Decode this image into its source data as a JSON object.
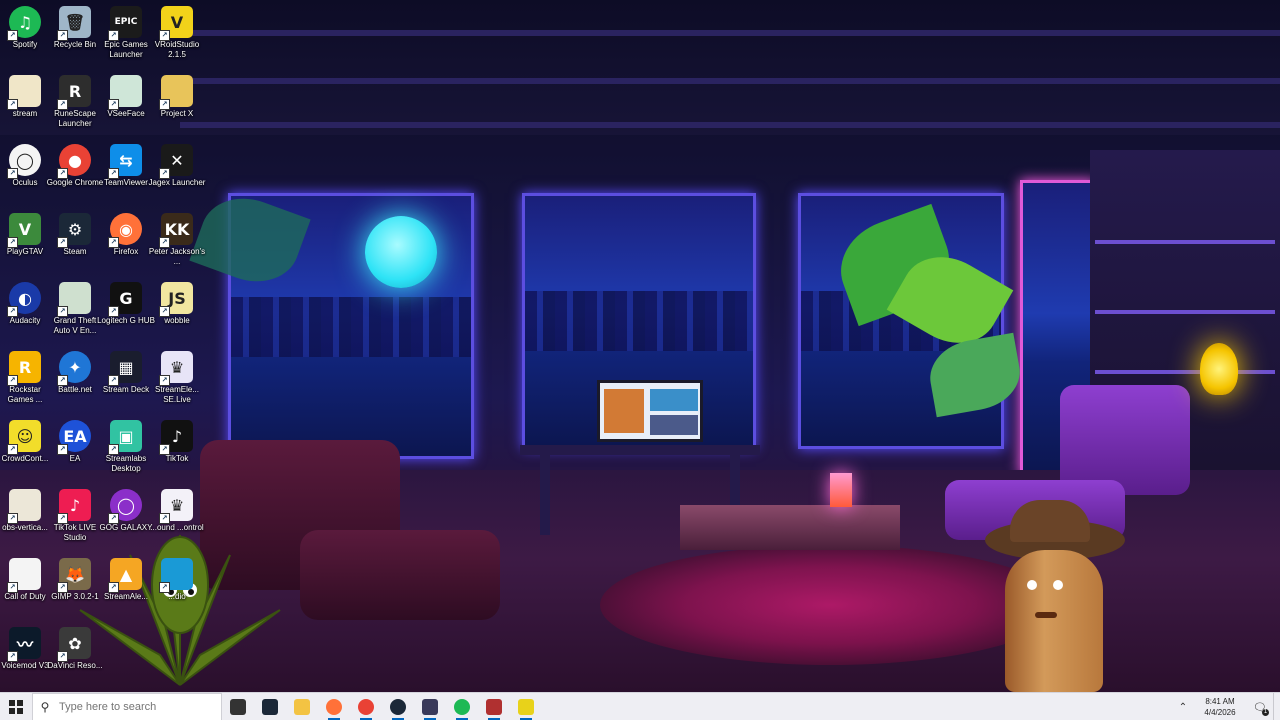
{
  "desktop": {
    "icons": [
      {
        "label": "Spotify",
        "color": "#1db954",
        "glyph": "♫"
      },
      {
        "label": "Recycle Bin",
        "color": "#9fb6c8",
        "glyph": "🗑"
      },
      {
        "label": "Epic Games Launcher",
        "color": "#1b1b1b",
        "glyph": "EPIC"
      },
      {
        "label": "VRoidStudio 2.1.5",
        "color": "#f2d21a",
        "glyph": "V"
      },
      {
        "label": "stream",
        "color": "#f0e6c8",
        "glyph": ""
      },
      {
        "label": "RuneScape Launcher",
        "color": "#2d2d2d",
        "glyph": "R"
      },
      {
        "label": "VSeeFace",
        "color": "#cfe6d8",
        "glyph": ""
      },
      {
        "label": "Project X",
        "color": "#e8c45a",
        "glyph": ""
      },
      {
        "label": "Oculus",
        "color": "#f4f4f4",
        "glyph": "◯"
      },
      {
        "label": "Google Chrome",
        "color": "#e94235",
        "glyph": "●"
      },
      {
        "label": "TeamViewer",
        "color": "#0e8ee9",
        "glyph": "⇆"
      },
      {
        "label": "Jagex Launcher",
        "color": "#1a1a1a",
        "glyph": "✕"
      },
      {
        "label": "PlayGTAV",
        "color": "#3c8a3c",
        "glyph": "V"
      },
      {
        "label": "Steam",
        "color": "#1b2838",
        "glyph": "⚙"
      },
      {
        "label": "Firefox",
        "color": "#ff7139",
        "glyph": "◉"
      },
      {
        "label": "Peter Jackson's ...",
        "color": "#3a2a1a",
        "glyph": "KK"
      },
      {
        "label": "Audacity",
        "color": "#1a3aa8",
        "glyph": "◐"
      },
      {
        "label": "Grand Theft Auto V En...",
        "color": "#cfe0cf",
        "glyph": ""
      },
      {
        "label": "Logitech G HUB",
        "color": "#111111",
        "glyph": "G"
      },
      {
        "label": "wobble",
        "color": "#f1e6a0",
        "glyph": "JS"
      },
      {
        "label": "Rockstar Games ...",
        "color": "#f6b400",
        "glyph": "R"
      },
      {
        "label": "Battle.net",
        "color": "#1f76d6",
        "glyph": "✦"
      },
      {
        "label": "Stream Deck",
        "color": "#1a1d2e",
        "glyph": "▦"
      },
      {
        "label": "StreamEle... SE.Live",
        "color": "#e7e4f7",
        "glyph": "♛"
      },
      {
        "label": "CrowdCont...",
        "color": "#f2dd2a",
        "glyph": "☺"
      },
      {
        "label": "EA",
        "color": "#1e52d8",
        "glyph": "EA"
      },
      {
        "label": "Streamlabs Desktop",
        "color": "#31c3a2",
        "glyph": "▣"
      },
      {
        "label": "TikTok",
        "color": "#111111",
        "glyph": "♪"
      },
      {
        "label": "obs-vertica...",
        "color": "#ece7d8",
        "glyph": ""
      },
      {
        "label": "TikTok LIVE Studio",
        "color": "#ee1d52",
        "glyph": "♪"
      },
      {
        "label": "GOG GALAXY",
        "color": "#8b2fc9",
        "glyph": "◯"
      },
      {
        "label": "...ound ...ontrol",
        "color": "#f3f1f8",
        "glyph": "♛"
      },
      {
        "label": "Call of Duty",
        "color": "#f4f4f4",
        "glyph": ""
      },
      {
        "label": "GIMP 3.0.2-1",
        "color": "#7a6a4a",
        "glyph": "🦊"
      },
      {
        "label": "StreamAle...",
        "color": "#f5a623",
        "glyph": "▲"
      },
      {
        "label": "...dio",
        "color": "#1a9ad6",
        "glyph": ""
      },
      {
        "label": "Voicemod V3",
        "color": "#0c1a2a",
        "glyph": "〰"
      },
      {
        "label": "DaVinci Reso...",
        "color": "#3a3a3a",
        "glyph": "✿"
      }
    ]
  },
  "taskbar": {
    "search_placeholder": "Type here to search",
    "apps": [
      {
        "name": "task-view",
        "color": "#333333"
      },
      {
        "name": "steam-overlay",
        "color": "#1b2838"
      },
      {
        "name": "file-explorer",
        "color": "#f3c343"
      },
      {
        "name": "firefox",
        "color": "#ff7139"
      },
      {
        "name": "chrome",
        "color": "#e94235"
      },
      {
        "name": "steam",
        "color": "#1b2838"
      },
      {
        "name": "obs",
        "color": "#3a3a5a"
      },
      {
        "name": "spotify",
        "color": "#1db954"
      },
      {
        "name": "app-red",
        "color": "#b03030"
      },
      {
        "name": "app-yellow",
        "color": "#e8d21a"
      }
    ],
    "time": "8:41 AM",
    "date": "4/4/2026",
    "notifications_count": "1"
  }
}
